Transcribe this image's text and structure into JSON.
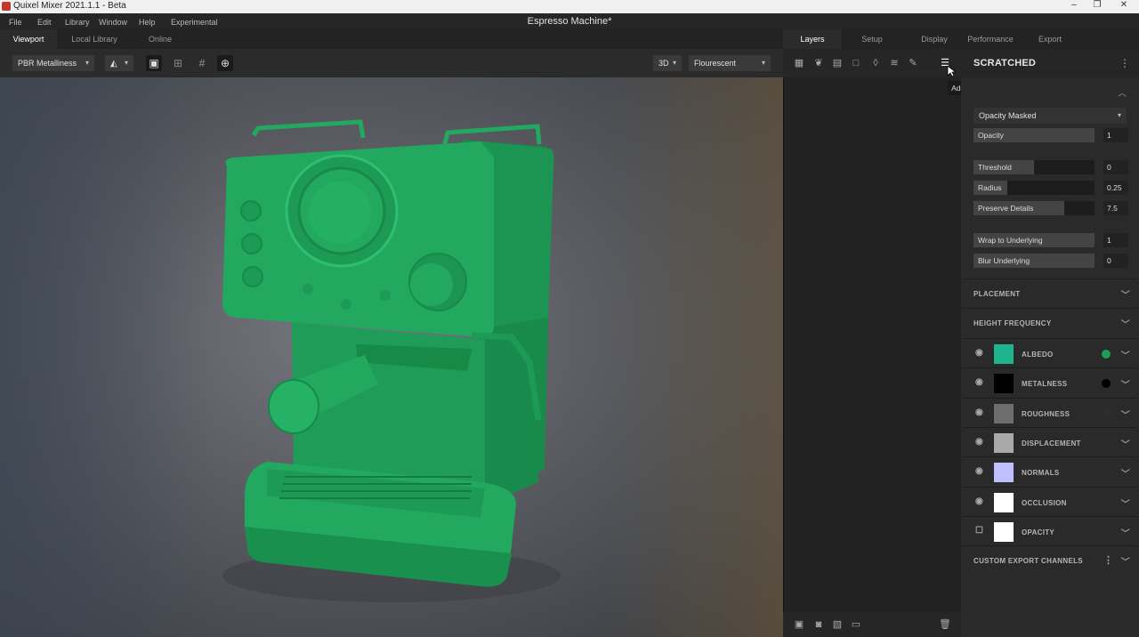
{
  "window": {
    "app_title": "Quixel Mixer 2021.1.1 - Beta",
    "minimize": "–",
    "maximize": "❐",
    "close": "✕"
  },
  "menu": [
    "File",
    "Edit",
    "Library",
    "Window",
    "Help",
    "Experimental"
  ],
  "document_title": "Espresso Machine*",
  "left_tabs": [
    "Viewport",
    "Local Library",
    "Online"
  ],
  "right_tabs": [
    "Layers",
    "Setup",
    "Display",
    "Performance",
    "Export"
  ],
  "toolbar": {
    "material_model": "PBR Metalliness",
    "view_mode": "3D",
    "lighting": "Flourescent"
  },
  "icons": {
    "shapes": "shapes-icon",
    "image": "image-icon",
    "grid4": "grid-icon",
    "grid": "grid-dense-icon",
    "target": "target-icon"
  },
  "layer_tools": [
    "paint-layer-icon",
    "atlas-icon",
    "mask-icon",
    "solid-icon",
    "fill-icon",
    "adjust-icon",
    "brush-icon",
    "add-layer-set-icon"
  ],
  "tooltip": "Add Layer Set",
  "properties": {
    "title": "SCRATCHED",
    "blend_mode": "Opacity Masked",
    "sliders": [
      {
        "label": "Opacity",
        "value": "1",
        "fraction": 1.0
      },
      {
        "label": "Threshold",
        "value": "0",
        "fraction": 0.5
      },
      {
        "label": "Radius",
        "value": "0.25",
        "fraction": 0.28
      },
      {
        "label": "Preserve Details",
        "value": "7.5",
        "fraction": 0.75
      },
      {
        "label": "Wrap to Underlying",
        "value": "1",
        "fraction": 1.0
      },
      {
        "label": "Blur Underlying",
        "value": "0",
        "fraction": 1.0
      }
    ],
    "sections": [
      "PLACEMENT",
      "HEIGHT FREQUENCY"
    ],
    "channels": [
      {
        "name": "ALBEDO",
        "swatch": "#1fb48d",
        "dot": "#1e9e55",
        "visible": true
      },
      {
        "name": "METALNESS",
        "swatch": "#000000",
        "dot": "#000000",
        "visible": true
      },
      {
        "name": "ROUGHNESS",
        "swatch": "#6e6e6e",
        "dot": "#2e2e2e",
        "visible": true
      },
      {
        "name": "DISPLACEMENT",
        "swatch": "#a9a9a9",
        "dot": "",
        "visible": true
      },
      {
        "name": "NORMALS",
        "swatch": "#bfbfff",
        "dot": "",
        "visible": true
      },
      {
        "name": "OCCLUSION",
        "swatch": "#ffffff",
        "dot": "",
        "visible": true
      },
      {
        "name": "OPACITY",
        "swatch": "#ffffff",
        "dot": "",
        "visible": false
      }
    ],
    "custom_export": "CUSTOM EXPORT CHANNELS"
  },
  "colors": {
    "model_green": "#22a85f",
    "model_dark": "#167a42"
  }
}
